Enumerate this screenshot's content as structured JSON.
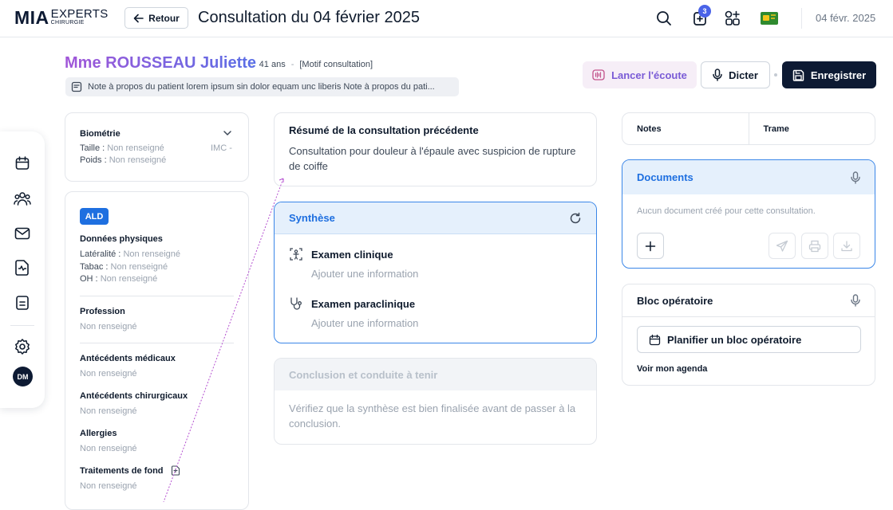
{
  "header": {
    "logo_main": "MIA",
    "logo_sub1": "EXPERTS",
    "logo_sub2": "CHIRURGIE",
    "back_label": "Retour",
    "title": "Consultation du 04 février 2025",
    "notif_count": "3",
    "date": "04 févr. 2025"
  },
  "patient": {
    "name": "Mme ROUSSEAU Juliette",
    "age": "41 ans",
    "motif": "[Motif consultation]",
    "note": "Note à propos du patient lorem ipsum sin dolor equam unc liberis Note à propos du pati..."
  },
  "actions": {
    "listen": "Lancer l'écoute",
    "dictate": "Dicter",
    "save": "Enregistrer"
  },
  "rail": {
    "avatar": "DM"
  },
  "biometrie": {
    "title": "Biométrie",
    "taille_label": "Taille :",
    "taille_value": "Non renseigné",
    "imc_label": "IMC -",
    "poids_label": "Poids :",
    "poids_value": "Non renseigné"
  },
  "dossier": {
    "badge": "ALD",
    "physique_title": "Données physiques",
    "lateralite_label": "Latéralité :",
    "lateralite_value": "Non renseigné",
    "tabac_label": "Tabac :",
    "tabac_value": "Non renseigné",
    "oh_label": "OH :",
    "oh_value": "Non renseigné",
    "sections": [
      {
        "title": "Profession",
        "value": "Non renseigné"
      },
      {
        "title": "Antécédents médicaux",
        "value": "Non renseigné"
      },
      {
        "title": "Antécédents chirurgicaux",
        "value": "Non renseigné"
      },
      {
        "title": "Allergies",
        "value": "Non renseigné"
      },
      {
        "title": "Traitements de fond",
        "value": "Non renseigné"
      }
    ]
  },
  "resume": {
    "title": "Résumé de la consultation précédente",
    "text": "Consultation pour douleur à l'épaule avec suspicion de rupture de coiffe"
  },
  "synthese": {
    "title": "Synthèse",
    "items": [
      {
        "title": "Examen clinique",
        "placeholder": "Ajouter une information"
      },
      {
        "title": "Examen paraclinique",
        "placeholder": "Ajouter une information"
      }
    ]
  },
  "conclusion": {
    "title": "Conclusion et conduite à tenir",
    "text": "Vérifiez que la synthèse est bien finalisée avant de passer à la conclusion."
  },
  "tabs": [
    "Notes",
    "Trame"
  ],
  "documents": {
    "title": "Documents",
    "empty": "Aucun document créé pour cette consultation."
  },
  "bloc": {
    "title": "Bloc opératoire",
    "plan_label": "Planifier un bloc opératoire",
    "agenda_link": "Voir mon agenda"
  },
  "colors": {
    "accent": "#1e6fe0",
    "dark": "#0d1a33",
    "name_gradient_start": "#a156d8",
    "name_gradient_end": "#5a6fe6"
  }
}
